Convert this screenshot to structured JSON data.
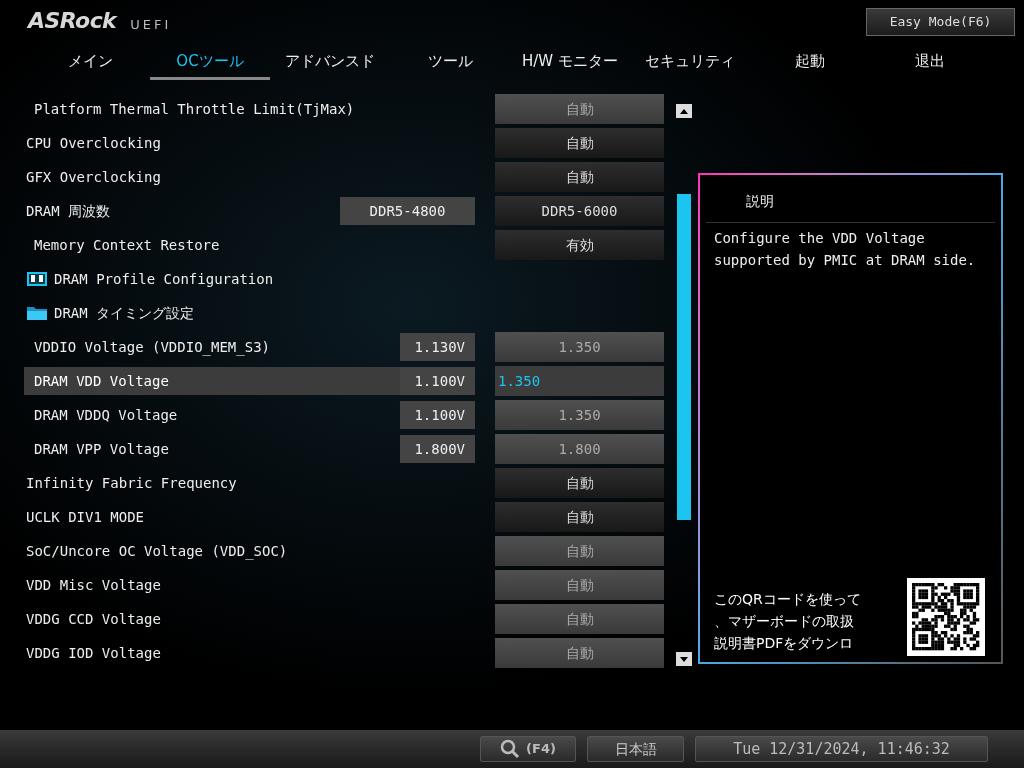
{
  "header": {
    "logo": "ASRock",
    "logo_suffix": "UEFI",
    "easy_mode_button": "Easy Mode(F6)"
  },
  "tabs": [
    {
      "label": "メイン",
      "selected": false
    },
    {
      "label": "OCツール",
      "selected": true
    },
    {
      "label": "アドバンスド",
      "selected": false
    },
    {
      "label": "ツール",
      "selected": false
    },
    {
      "label": "H/W モニター",
      "selected": false
    },
    {
      "label": "セキュリティ",
      "selected": false
    },
    {
      "label": "起動",
      "selected": false
    },
    {
      "label": "退出",
      "selected": false
    }
  ],
  "settings": [
    {
      "kind": "setting",
      "label": "Platform Thermal Throttle Limit(TjMax)",
      "indented": true,
      "value": "自動",
      "disabled": true,
      "selected": false
    },
    {
      "kind": "setting",
      "label": "CPU Overclocking",
      "indented": false,
      "value": "自動",
      "disabled": false,
      "selected": false
    },
    {
      "kind": "setting",
      "label": "GFX Overclocking",
      "indented": false,
      "value": "自動",
      "disabled": false,
      "selected": false
    },
    {
      "kind": "setting",
      "label": "DRAM 周波数",
      "indented": false,
      "current": "DDR5-4800",
      "value": "DDR5-6000",
      "disabled": false,
      "selected": false
    },
    {
      "kind": "setting",
      "label": "Memory Context Restore",
      "indented": true,
      "value": "有効",
      "disabled": false,
      "selected": false
    },
    {
      "kind": "profile",
      "label": "DRAM Profile Configuration",
      "indented": false,
      "selected": false
    },
    {
      "kind": "folder",
      "label": "DRAM タイミング設定",
      "indented": false,
      "selected": false
    },
    {
      "kind": "setting",
      "label": "VDDIO Voltage (VDDIO_MEM_S3)",
      "indented": true,
      "current": "1.130V",
      "value": "1.350",
      "disabled": true,
      "selected": false
    },
    {
      "kind": "setting",
      "label": "DRAM VDD Voltage",
      "indented": true,
      "current": "1.100V",
      "value": "1.350",
      "disabled": true,
      "selected": true
    },
    {
      "kind": "setting",
      "label": "DRAM VDDQ Voltage",
      "indented": true,
      "current": "1.100V",
      "value": "1.350",
      "disabled": true,
      "selected": false
    },
    {
      "kind": "setting",
      "label": "DRAM VPP Voltage",
      "indented": true,
      "current": "1.800V",
      "value": "1.800",
      "disabled": true,
      "selected": false
    },
    {
      "kind": "setting",
      "label": "Infinity Fabric Frequency",
      "indented": false,
      "value": "自動",
      "disabled": false,
      "selected": false
    },
    {
      "kind": "setting",
      "label": "UCLK DIV1 MODE",
      "indented": false,
      "value": "自動",
      "disabled": false,
      "selected": false
    },
    {
      "kind": "setting",
      "label": "SoC/Uncore OC Voltage (VDD_SOC)",
      "indented": false,
      "value": "自動",
      "disabled": true,
      "selected": false
    },
    {
      "kind": "setting",
      "label": "VDD Misc Voltage",
      "indented": false,
      "value": "自動",
      "disabled": true,
      "selected": false
    },
    {
      "kind": "setting",
      "label": "VDDG CCD Voltage",
      "indented": false,
      "value": "自動",
      "disabled": true,
      "selected": false
    },
    {
      "kind": "setting",
      "label": "VDDG IOD Voltage",
      "indented": false,
      "value": "自動",
      "disabled": true,
      "selected": false
    }
  ],
  "help_panel": {
    "title": "説明",
    "text": "Configure the VDD Voltage supported by PMIC at DRAM side.",
    "qr_text": [
      "このQRコードを使って",
      "、マザーボードの取扱",
      "説明書PDFをダウンロ"
    ]
  },
  "status_bar": {
    "search_key": "(F4)",
    "language": "日本語",
    "datetime": "Tue 12/31/2024, 11:46:32"
  }
}
